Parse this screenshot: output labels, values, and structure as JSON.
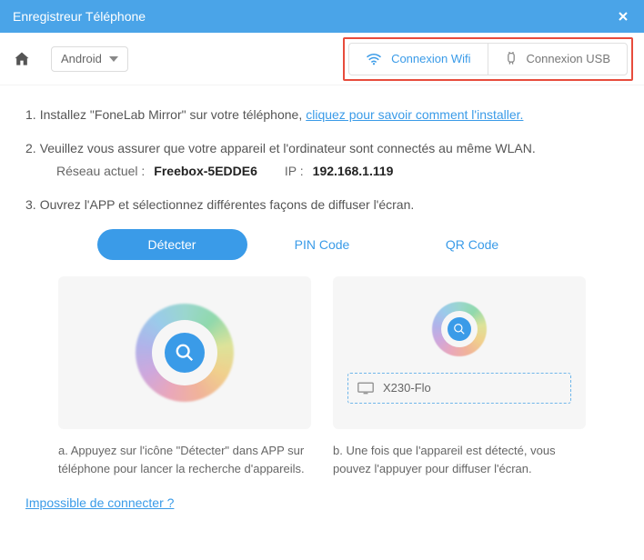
{
  "window": {
    "title": "Enregistreur Téléphone"
  },
  "toolbar": {
    "platform": "Android",
    "conn_wifi": "Connexion Wifi",
    "conn_usb": "Connexion USB"
  },
  "steps": {
    "s1_num": "1.",
    "s1_text": "Installez \"FoneLab Mirror\" sur votre téléphone,",
    "s1_link": "cliquez pour savoir comment l'installer.",
    "s2_num": "2.",
    "s2_text": "Veuillez vous assurer que votre appareil et l'ordinateur sont connectés au même WLAN.",
    "s2_net_label": "Réseau actuel :",
    "s2_net_value": "Freebox-5EDDE6",
    "s2_ip_label": "IP :",
    "s2_ip_value": "192.168.1.119",
    "s3_num": "3.",
    "s3_text": "Ouvrez l'APP et sélectionnez différentes façons de diffuser l'écran."
  },
  "tabs": {
    "detect": "Détecter",
    "pin": "PIN Code",
    "qr": "QR Code"
  },
  "cards": {
    "a_caption": "a. Appuyez sur l'icône \"Détecter\" dans APP sur téléphone pour lancer la recherche d'appareils.",
    "b_device": "X230-Flo",
    "b_caption": "b. Une fois que l'appareil est détecté, vous pouvez l'appuyer pour diffuser l'écran."
  },
  "footer": {
    "cant_connect": "Impossible de connecter ?"
  }
}
